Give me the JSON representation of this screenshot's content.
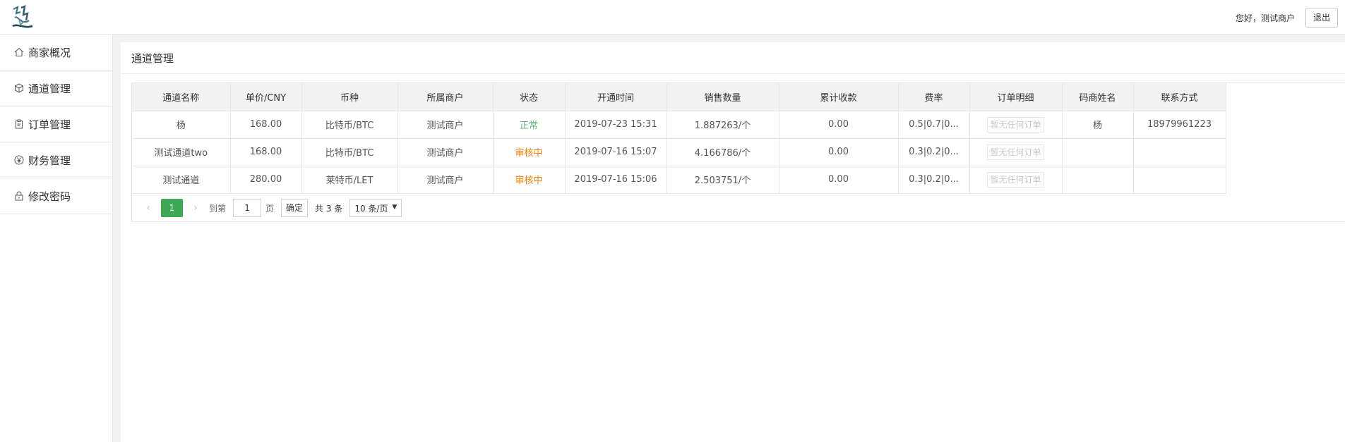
{
  "header": {
    "logo_alt": "好道",
    "greeting": "您好，测试商户",
    "logout_label": "退出"
  },
  "sidebar": {
    "items": [
      {
        "label": "商家概况",
        "icon": "home-icon"
      },
      {
        "label": "通道管理",
        "icon": "cube-icon"
      },
      {
        "label": "订单管理",
        "icon": "clipboard-icon"
      },
      {
        "label": "财务管理",
        "icon": "yen-icon"
      },
      {
        "label": "修改密码",
        "icon": "lock-icon"
      }
    ]
  },
  "page": {
    "title": "通道管理"
  },
  "table": {
    "columns": [
      "通道名称",
      "单价/CNY",
      "币种",
      "所属商户",
      "状态",
      "开通时间",
      "销售数量",
      "累计收款",
      "费率",
      "订单明细",
      "码商姓名",
      "联系方式"
    ],
    "rows": [
      {
        "name": "杨",
        "price": "168.00",
        "coin": "比特币/BTC",
        "merchant": "测试商户",
        "status": "正常",
        "status_type": "ok",
        "opened": "2019-07-23 15:31",
        "sold": "1.887263/个",
        "received": "0.00",
        "rate": "0.5|0.7|0...",
        "orders": "暂无任何订单",
        "agent": "杨",
        "contact": "18979961223"
      },
      {
        "name": "测试通道two",
        "price": "168.00",
        "coin": "比特币/BTC",
        "merchant": "测试商户",
        "status": "审核中",
        "status_type": "wait",
        "opened": "2019-07-16 15:07",
        "sold": "4.166786/个",
        "received": "0.00",
        "rate": "0.3|0.2|0...",
        "orders": "暂无任何订单",
        "agent": "",
        "contact": ""
      },
      {
        "name": "测试通道",
        "price": "280.00",
        "coin": "莱特币/LET",
        "merchant": "测试商户",
        "status": "审核中",
        "status_type": "wait",
        "opened": "2019-07-16 15:06",
        "sold": "2.503751/个",
        "received": "0.00",
        "rate": "0.3|0.2|0...",
        "orders": "暂无任何订单",
        "agent": "",
        "contact": ""
      }
    ]
  },
  "pager": {
    "prev_icon": "chevron-left-icon",
    "next_icon": "chevron-right-icon",
    "current_page": "1",
    "goto_label": "到第",
    "goto_value": "1",
    "page_unit": "页",
    "confirm_label": "确定",
    "total_label": "共 3 条",
    "page_size": "10 条/页"
  },
  "colors": {
    "accent_green": "#3da954",
    "status_ok": "#5fb878",
    "status_wait": "#ff7d00"
  }
}
